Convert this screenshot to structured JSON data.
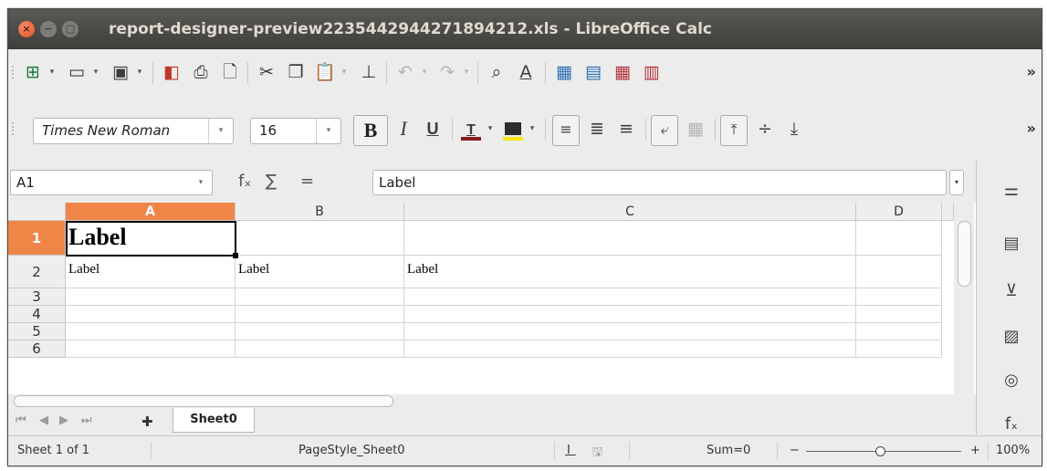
{
  "window": {
    "title": "report-designer-preview2235442944271894212.xls - LibreOffice Calc"
  },
  "toolbar": {
    "more": "»",
    "icons": [
      "table-icon",
      "open-folder-icon",
      "save-icon",
      "export-pdf-icon",
      "print-icon",
      "print-preview-icon",
      "cut-icon",
      "copy-icon",
      "paste-icon",
      "clone-formatting-icon",
      "undo-icon",
      "redo-icon",
      "find-replace-icon",
      "spelling-icon",
      "row-insert-icon",
      "column-insert-icon",
      "row-delete-icon",
      "column-delete-icon"
    ]
  },
  "formatting": {
    "font_name": "Times New Roman",
    "font_size": "16",
    "bold": "B",
    "italic": "I",
    "underline": "U",
    "more": "»",
    "font_color": "#8b1a1a",
    "highlight_color": "#f5e616"
  },
  "formula_bar": {
    "cell_ref": "A1",
    "fx": "fₓ",
    "sum": "∑",
    "equals": "=",
    "content": "Label"
  },
  "sheet": {
    "columns": [
      "A",
      "B",
      "C",
      "D"
    ],
    "selected_column": "A",
    "rows": [
      "1",
      "2",
      "3",
      "4",
      "5",
      "6"
    ],
    "selected_row": "1",
    "cells": {
      "A1": "Label",
      "A2": "Label",
      "B2": "Label",
      "C2": "Label"
    }
  },
  "tabs": {
    "add": "✚",
    "sheets": [
      "Sheet0"
    ]
  },
  "status": {
    "sheet": "Sheet 1 of 1",
    "page_style": "PageStyle_Sheet0",
    "sum": "Sum=0",
    "zoom_minus": "−",
    "zoom_plus": "+",
    "zoom": "100%"
  },
  "sidebar": {
    "icons": [
      "properties-icon",
      "page-icon",
      "styles-icon",
      "gallery-icon",
      "navigator-icon",
      "functions-icon"
    ]
  }
}
